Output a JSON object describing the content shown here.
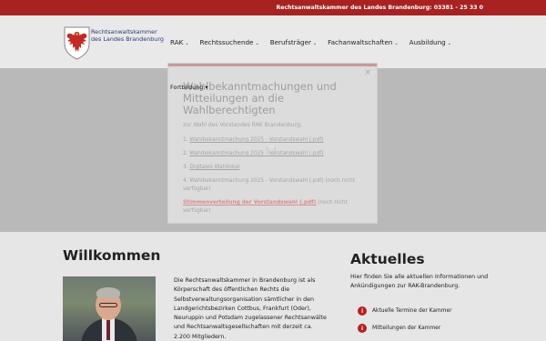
{
  "topbar": {
    "text": "Rechtsanwaltskammer des Landes Brandenburg: 03381 - 25 33 0"
  },
  "logo": {
    "line1": "Rechtsanwaltskammer",
    "line2": "des Landes Brandenburg"
  },
  "nav": [
    {
      "label": "RAK"
    },
    {
      "label": "Rechtssuchende"
    },
    {
      "label": "Berufsträger"
    },
    {
      "label": "Fachanwaltschaften"
    },
    {
      "label": "Ausbildung"
    }
  ],
  "hero": {
    "sub_label": "Fortbildung",
    "sub_icon": "chevron-down-icon"
  },
  "modal": {
    "close": "×",
    "title": "Wahlbekanntmachungen und Mitteilungen an die Wahlberechtigten",
    "intro": "zur Wahl des Vorstandes RAK Brandenburg:",
    "items": [
      {
        "prefix": "1. ",
        "link": "Wahlbekanntmachung 2025 - Vorstandswahl (.pdf)",
        "suffix": ""
      },
      {
        "prefix": "2. ",
        "link": "Wahlbekanntmachung 2025 - Vorstandswahl (.pdf)",
        "suffix": ""
      },
      {
        "prefix": "3. ",
        "link": "Digitales Wahllokal",
        "suffix": ""
      },
      {
        "prefix": "4. Wahlbekanntmachung 2025 - Vorstandswahl (.pdf) (noch nicht verfügbar)",
        "link": "",
        "suffix": ""
      },
      {
        "prefix": "",
        "link": "Stimmenverteilung der Vorstandswahl (.pdf)",
        "suffix": " (noch nicht verfügbar)"
      }
    ]
  },
  "welcome": {
    "title": "Willkommen",
    "text": "Die Rechtsanwaltskammer in Brandenburg ist als Körperschaft des öffentlichen Rechts die Selbstverwaltungsorganisation sämtlicher in den Landgerichtsbezirken Cottbus, Frankfurt (Oder), Neuruppin und Potsdam zugelassener Rechtsanwälte und Rechtsanwaltsgesellschaften mit derzeit ca. 2.200 Mitgliedern."
  },
  "news": {
    "title": "Aktuelles",
    "text": "Hier finden Sie alle aktuellen Informationen und Ankündigungen zur RAK-Brandenburg.",
    "items": [
      {
        "label": "Aktuelle Termine der Kammer",
        "icon": "info-icon",
        "badge": "i"
      },
      {
        "label": "Mitteilungen der Kammer",
        "icon": "info-icon",
        "badge": "i"
      }
    ]
  },
  "colors": {
    "accent": "#a82222",
    "logo_text": "#253c7a"
  }
}
